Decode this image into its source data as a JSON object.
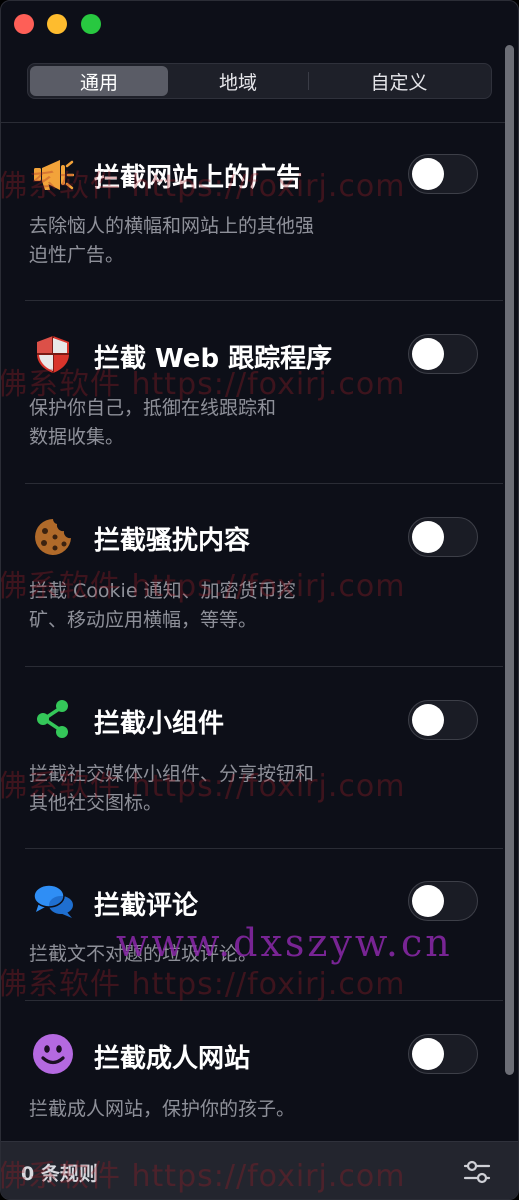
{
  "tabs": [
    {
      "label": "通用",
      "active": true
    },
    {
      "label": "地域",
      "active": false
    },
    {
      "label": "自定义",
      "active": false
    }
  ],
  "items": [
    {
      "icon": "megaphone-icon",
      "title": "拦截网站上的广告",
      "desc_lines": [
        "去除恼人的横幅和网站上的其他强",
        "迫性广告。"
      ],
      "enabled": false
    },
    {
      "icon": "shield-icon",
      "title": "拦截 Web 跟踪程序",
      "desc_lines": [
        "保护你自己，抵御在线跟踪和",
        "数据收集。"
      ],
      "enabled": false
    },
    {
      "icon": "cookie-icon",
      "title": "拦截骚扰内容",
      "desc_lines": [
        "拦截 Cookie 通知、加密货币挖",
        "矿、移动应用横幅，等等。"
      ],
      "enabled": false
    },
    {
      "icon": "share-icon",
      "title": "拦截小组件",
      "desc_lines": [
        "拦截社交媒体小组件、分享按钮和",
        "其他社交图标。"
      ],
      "enabled": false
    },
    {
      "icon": "chat-bubbles-icon",
      "title": "拦截评论",
      "desc_lines": [
        "拦截文不对题的垃圾评论。"
      ],
      "enabled": false
    },
    {
      "icon": "smiley-icon",
      "title": "拦截成人网站",
      "desc_lines": [
        "拦截成人网站，保护你的孩子。"
      ],
      "enabled": false
    }
  ],
  "footer": {
    "rules_count": "0 条规则",
    "settings_icon": "sliders-icon"
  },
  "watermarks": {
    "foxirj": "佛系软件 https://foxirj.com",
    "site": "www.dxszyw.cn"
  },
  "colors": {
    "background": "#0d0f18",
    "tab_active": "#5a5c66",
    "description_text": "#8e9099",
    "megaphone": "#f2a33a",
    "shield": "#d9342b",
    "cookie": "#b06a2a",
    "share": "#34c759",
    "chat": "#2f8ef5",
    "smiley": "#b469e0"
  }
}
